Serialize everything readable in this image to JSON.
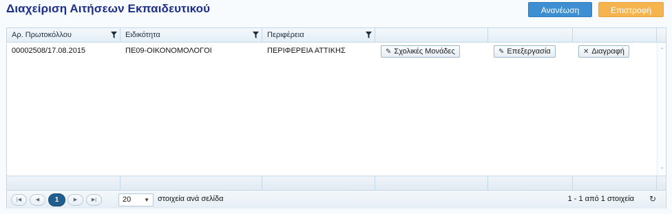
{
  "header": {
    "title": "Διαχείριση Αιτήσεων Εκπαιδευτικού",
    "refresh_label": "Ανανέωση",
    "back_label": "Επιστροφή"
  },
  "colors": {
    "title": "#1b2f8a",
    "refresh": "#3e8fd1",
    "back": "#f6b44f",
    "active_page": "#1f5e8f"
  },
  "grid": {
    "columns": [
      "Αρ. Πρωτοκόλλου",
      "Ειδικότητα",
      "Περιφέρεια",
      "",
      "",
      ""
    ],
    "rows": [
      {
        "protocol": "00002508/17.08.2015",
        "specialty": "ΠΕ09-ΟΙΚΟΝΟΜΟΛΟΓΟΙ",
        "region": "ΠΕΡΙΦΕΡΕΙΑ ΑΤΤΙΚΗΣ",
        "schools_label": "Σχολικές Μονάδες",
        "edit_label": "Επεξεργασία",
        "delete_label": "Διαγραφή"
      }
    ],
    "icons": {
      "filter": "filter-icon",
      "edit": "pencil-icon",
      "delete": "close-icon",
      "refresh": "refresh-icon"
    }
  },
  "pager": {
    "first": "|◀",
    "prev": "◀",
    "current_page": "1",
    "next": "▶",
    "last": "▶|",
    "page_size": "20",
    "per_page_label": "στοιχεία ανά σελίδα",
    "range_text": "1 - 1 από 1 στοιχεία"
  }
}
